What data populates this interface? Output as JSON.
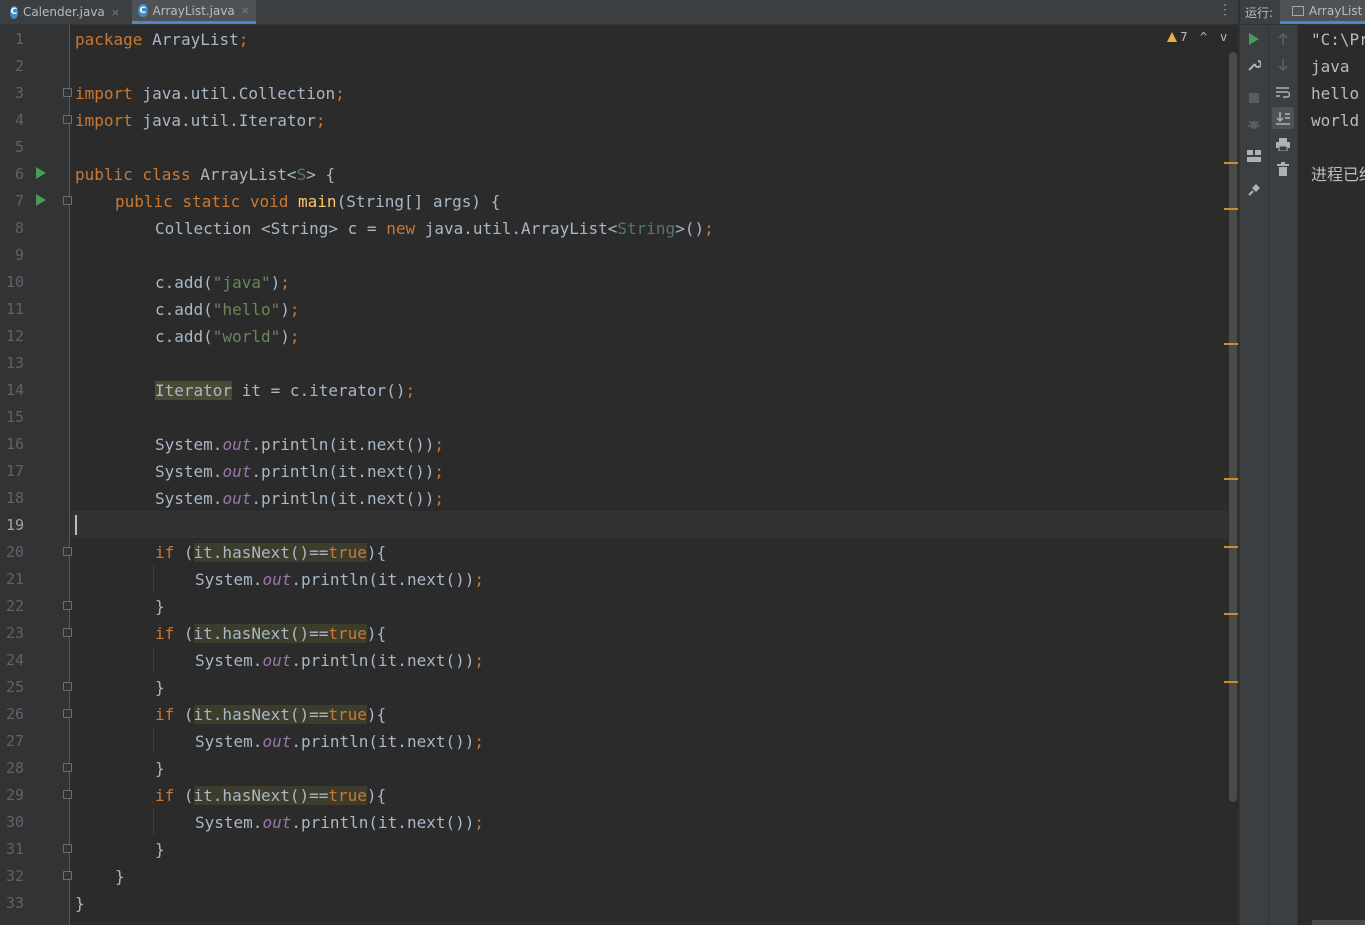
{
  "tabs": [
    {
      "icon": "C",
      "label": "Calender.java",
      "close": "×",
      "active": false
    },
    {
      "icon": "C",
      "label": "ArrayList.java",
      "close": "×",
      "active": true
    }
  ],
  "tab_menu": "⋮",
  "editor": {
    "warnings_count": "7",
    "nav_up": "^",
    "nav_down": "v",
    "current_line": "19",
    "line_numbers": [
      "1",
      "2",
      "3",
      "4",
      "5",
      "6",
      "7",
      "8",
      "9",
      "10",
      "11",
      "12",
      "13",
      "14",
      "15",
      "16",
      "17",
      "18",
      "19",
      "20",
      "21",
      "22",
      "23",
      "24",
      "25",
      "26",
      "27",
      "28",
      "29",
      "30",
      "31",
      "32",
      "33"
    ],
    "code": {
      "l1": {
        "kw": "package",
        "rest": " ArrayList",
        "semi": ";"
      },
      "l3": {
        "kw": "import",
        "rest": " java.util.Collection",
        "semi": ";"
      },
      "l4": {
        "kw": "import",
        "rest": " java.util.Iterator",
        "semi": ";"
      },
      "l6": {
        "kw": "public class",
        "name": " ArrayList<",
        "tp": "S",
        "end": "> {"
      },
      "l7": {
        "kw": "public static void",
        "mth": "main",
        "rest": "(String[] args) {"
      },
      "l8": {
        "a": "Collection <String> c = ",
        "kw": "new",
        "b": " java.util.ArrayList<",
        "tp": "String",
        "c": ">()",
        "semi": ";"
      },
      "l10": {
        "a": "c.add(",
        "str": "\"java\"",
        "b": ")",
        "semi": ";"
      },
      "l11": {
        "a": "c.add(",
        "str": "\"hello\"",
        "b": ")",
        "semi": ";"
      },
      "l12": {
        "a": "c.add(",
        "str": "\"world\"",
        "b": ")",
        "semi": ";"
      },
      "l14": {
        "hl": "Iterator",
        "rest": " it = c.iterator()",
        "semi": ";"
      },
      "println": {
        "a": "System.",
        "fld": "out",
        "b": ".println(it.next())",
        "semi": ";"
      },
      "if": {
        "kw": "if",
        "a": " (",
        "hl": "it.hasNext()==",
        "hlkw": "true",
        "b": "){"
      },
      "close_brace": "}"
    }
  },
  "run_window": {
    "label": "运行:",
    "tab_label": "ArrayList",
    "output": [
      "\"C:\\Pr",
      "java",
      "hello",
      "world",
      "",
      "进程已结"
    ]
  }
}
